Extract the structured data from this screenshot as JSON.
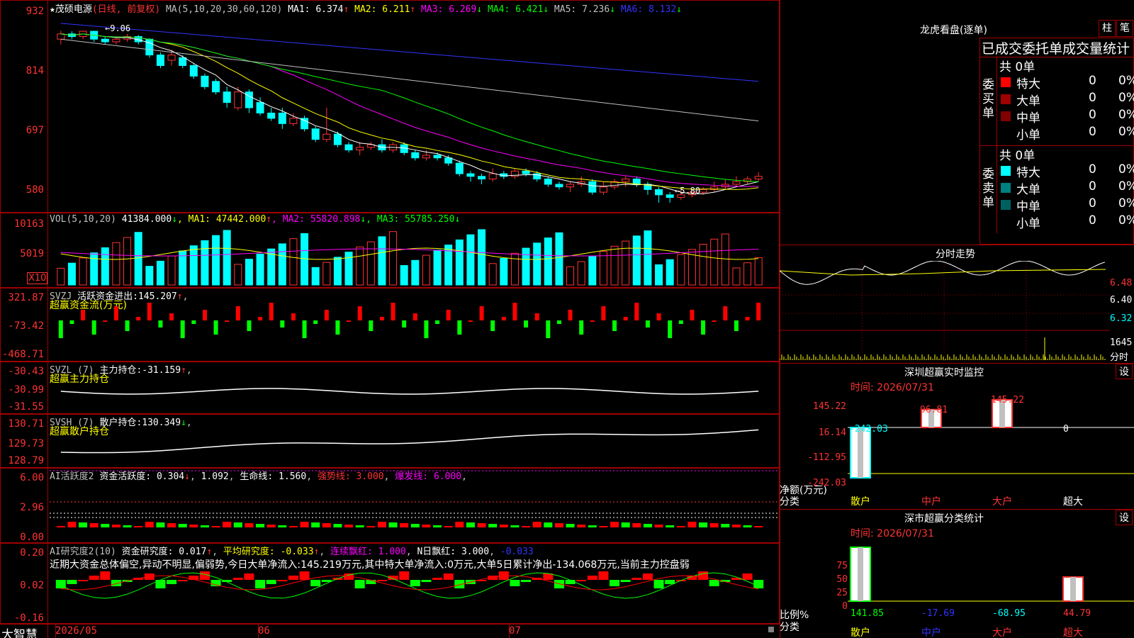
{
  "stock": {
    "star": "★",
    "name": "茂硕电源",
    "mode": "(日线, 前复权)"
  },
  "main": {
    "ma_label": "MA(5,10,20,30,60,120)",
    "ma": [
      {
        "label": "MA1:",
        "value": "6.374",
        "arrow": "↑",
        "color": "#ffffff"
      },
      {
        "label": "MA2:",
        "value": "6.211",
        "arrow": "↑",
        "color": "#ffff00"
      },
      {
        "label": "MA3:",
        "value": "6.269",
        "arrow": "↓",
        "color": "#ff00ff"
      },
      {
        "label": "MA4:",
        "value": "6.421",
        "arrow": "↓",
        "color": "#00ff00"
      },
      {
        "label": "MA5:",
        "value": "7.236",
        "arrow": "↓",
        "color": "#c0c0c0"
      },
      {
        "label": "MA6:",
        "value": "8.132",
        "arrow": "↓",
        "color": "#3333ff"
      }
    ],
    "y_labels": [
      "932",
      "814",
      "697",
      "580"
    ],
    "high_marker": "9.06",
    "low_marker": "5.80"
  },
  "vol": {
    "title": "VOL(5,10,20)",
    "value": "41384.000",
    "arrow": "↓",
    "ma": [
      {
        "label": "MA1:",
        "value": "47442.000",
        "arrow": "↑",
        "color": "#ffff00"
      },
      {
        "label": "MA2:",
        "value": "55820.898",
        "arrow": "↓",
        "color": "#ff00ff"
      },
      {
        "label": "MA3:",
        "value": "55785.250",
        "arrow": "↓",
        "color": "#00ff00"
      }
    ],
    "y_labels": [
      "10163",
      "5019"
    ],
    "unit": "X10"
  },
  "svzj": {
    "title": "SVZJ",
    "label": "活跃资金进出:",
    "value": "145.207",
    "arrow": "↑",
    "subtitle": "超赢资金流(万元)",
    "y_labels": [
      "321.87",
      "-73.42",
      "-468.71"
    ]
  },
  "svzl": {
    "title": "SVZL (7)",
    "label": "主力持仓:",
    "value": "-31.159",
    "arrow": "↑",
    "subtitle": "超赢主力持仓",
    "y_labels": [
      "-30.43",
      "-30.99",
      "-31.55"
    ]
  },
  "svsh": {
    "title": "SVSH (7)",
    "label": "散户持仓:",
    "value": "130.349",
    "arrow": "↓",
    "subtitle": "超赢散户持仓",
    "y_labels": [
      "130.71",
      "129.73",
      "128.79"
    ]
  },
  "ai1": {
    "title": "AI活跃度2",
    "label": "资金活跃度:",
    "value": "0.304",
    "value2": "1.092",
    "life_label": "生命线:",
    "life_value": "1.560",
    "strong_label": "强势线:",
    "strong_value": "3.000",
    "burst_label": "爆发线:",
    "burst_value": "6.000",
    "y_labels": [
      "6.00",
      "2.96",
      "0.00"
    ]
  },
  "ai2": {
    "title": "AI研究度2(10)",
    "label": "资金研究度:",
    "value": "0.017",
    "avg_label": "平均研究度:",
    "avg_value": "-0.033",
    "red_label": "连续飘红:",
    "red_value": "1.000",
    "n_label": "N日飘红:",
    "n_value": "3.000",
    "last_value": "-0.033",
    "comment": "近期大资金总体偏空,异动不明显,偏弱势,今日大单净流入:145.219万元,其中特大单净流入:0万元,大单5日累计净出-134.068万元,当前主力控盘弱",
    "y_labels": [
      "0.20",
      "0.02",
      "-0.16"
    ]
  },
  "xaxis": {
    "brand": "大智慧",
    "labels": [
      "2026/05",
      "06",
      "07"
    ]
  },
  "right": {
    "dragon_title": "龙虎看盘(逐单)",
    "btn_zhu": "柱",
    "btn_bi": "笔",
    "orders_title": "已成交委托单成交量统计",
    "buy": {
      "total": "共 0单",
      "side_label": "委买单",
      "rows": [
        {
          "name": "特大",
          "count": "0",
          "pct": "0%",
          "color": "#ff0000"
        },
        {
          "name": "大单",
          "count": "0",
          "pct": "0%",
          "color": "#a00000"
        },
        {
          "name": "中单",
          "count": "0",
          "pct": "0%",
          "color": "#800000"
        },
        {
          "name": "小单",
          "count": "0",
          "pct": "0%",
          "color": "#000000"
        }
      ]
    },
    "sell": {
      "total": "共 0单",
      "side_label": "委卖单",
      "rows": [
        {
          "name": "特大",
          "count": "0",
          "pct": "0%",
          "color": "#00ffff"
        },
        {
          "name": "大单",
          "count": "0",
          "pct": "0%",
          "color": "#008080"
        },
        {
          "name": "中单",
          "count": "0",
          "pct": "0%",
          "color": "#006060"
        },
        {
          "name": "小单",
          "count": "0",
          "pct": "0%",
          "color": "#000000"
        }
      ]
    },
    "intraday": {
      "title": "分时走势",
      "y_labels": [
        "6.48",
        "6.40",
        "6.32"
      ],
      "vol_label": "1645",
      "vol_caption": "分时"
    },
    "monitor": {
      "title": "深圳超赢实时监控",
      "btn": "设",
      "time": "时间: 2026/07/31",
      "y_labels": [
        "145.22",
        "16.14",
        "-112.95",
        "-242.03"
      ],
      "values": {
        "retail": "-242.03",
        "mid": "96.81",
        "big": "145.22",
        "super": "0"
      },
      "chart_data": {
        "type": "bar",
        "categories": [
          "散户",
          "中户",
          "大户",
          "超大"
        ],
        "values": [
          -242.03,
          96.81,
          145.22,
          0
        ],
        "ylabel": "净额(万元)",
        "xlabel": "分类",
        "ylim": [
          -242.03,
          145.22
        ]
      },
      "net_label": "净额(万元)",
      "cat_label": "分类",
      "categories": [
        "散户",
        "中户",
        "大户",
        "超大"
      ]
    },
    "classify": {
      "title": "深市超赢分类统计",
      "btn": "设",
      "time": "时间: 2026/07/31",
      "y_labels": [
        "75",
        "50",
        "25",
        "0"
      ],
      "values": [
        "141.85",
        "-17.69",
        "-68.95",
        "44.79"
      ],
      "chart_data": {
        "type": "bar",
        "categories": [
          "散户",
          "中户",
          "大户",
          "超大"
        ],
        "values": [
          141.85,
          -17.69,
          -68.95,
          44.79
        ],
        "ylabel": "比例%",
        "xlabel": "分类",
        "ylim": [
          0,
          100
        ]
      },
      "ratio_label": "比例%",
      "cat_label": "分类",
      "categories": [
        "散户",
        "中户",
        "大户",
        "超大"
      ]
    }
  },
  "chart_data": [
    {
      "type": "candlestick",
      "title": "茂硕电源(日线, 前复权)",
      "ylim": [
        5.8,
        9.32
      ],
      "annotations": [
        {
          "text": "9.06"
        },
        {
          "text": "5.80"
        }
      ],
      "candles": [
        [
          8.9,
          9.0,
          9.06,
          8.8
        ],
        [
          9.0,
          8.95,
          9.05,
          8.9
        ],
        [
          8.95,
          9.05,
          9.06,
          8.9
        ],
        [
          9.05,
          8.9,
          9.06,
          8.85
        ],
        [
          8.9,
          8.85,
          8.95,
          8.8
        ],
        [
          8.85,
          8.9,
          8.95,
          8.8
        ],
        [
          8.9,
          8.95,
          9.0,
          8.85
        ],
        [
          8.95,
          8.85,
          8.98,
          8.8
        ],
        [
          8.9,
          8.6,
          8.92,
          8.55
        ],
        [
          8.6,
          8.4,
          8.65,
          8.35
        ],
        [
          8.5,
          8.6,
          8.7,
          8.4
        ],
        [
          8.55,
          8.4,
          8.6,
          8.35
        ],
        [
          8.4,
          8.2,
          8.45,
          8.15
        ],
        [
          8.2,
          8.0,
          8.25,
          7.95
        ],
        [
          8.1,
          7.9,
          8.15,
          7.85
        ],
        [
          7.9,
          7.7,
          8.0,
          7.6
        ],
        [
          7.6,
          7.9,
          8.0,
          7.55
        ],
        [
          7.9,
          7.6,
          7.95,
          7.5
        ],
        [
          7.7,
          7.5,
          7.8,
          7.45
        ],
        [
          7.5,
          7.4,
          7.6,
          7.35
        ],
        [
          7.5,
          7.3,
          7.6,
          7.2
        ],
        [
          7.3,
          7.4,
          7.5,
          7.25
        ],
        [
          7.4,
          7.2,
          7.45,
          7.15
        ],
        [
          7.2,
          7.0,
          7.25,
          6.95
        ],
        [
          7.0,
          7.1,
          7.6,
          6.95
        ],
        [
          7.1,
          6.9,
          7.15,
          6.85
        ],
        [
          6.9,
          6.8,
          6.95,
          6.75
        ],
        [
          6.8,
          6.85,
          6.95,
          6.7
        ],
        [
          6.85,
          6.9,
          6.95,
          6.8
        ],
        [
          6.9,
          6.8,
          7.0,
          6.75
        ],
        [
          6.8,
          6.9,
          6.95,
          6.75
        ],
        [
          6.9,
          6.75,
          6.95,
          6.7
        ],
        [
          6.75,
          6.65,
          6.8,
          6.6
        ],
        [
          6.65,
          6.7,
          6.8,
          6.6
        ],
        [
          6.7,
          6.65,
          6.75,
          6.6
        ],
        [
          6.65,
          6.55,
          6.7,
          6.5
        ],
        [
          6.55,
          6.35,
          6.6,
          6.3
        ],
        [
          6.35,
          6.3,
          6.4,
          6.2
        ],
        [
          6.3,
          6.25,
          6.35,
          6.15
        ],
        [
          6.25,
          6.35,
          6.45,
          6.2
        ],
        [
          6.35,
          6.3,
          6.4,
          6.25
        ],
        [
          6.3,
          6.4,
          6.45,
          6.25
        ],
        [
          6.4,
          6.35,
          6.45,
          6.3
        ],
        [
          6.35,
          6.25,
          6.4,
          6.2
        ],
        [
          6.25,
          6.15,
          6.3,
          6.1
        ],
        [
          6.15,
          6.1,
          6.2,
          6.05
        ],
        [
          6.1,
          6.15,
          6.2,
          6.0
        ],
        [
          6.15,
          6.2,
          6.3,
          6.1
        ],
        [
          6.2,
          6.0,
          6.25,
          5.95
        ],
        [
          6.0,
          6.1,
          6.2,
          5.95
        ],
        [
          6.1,
          6.2,
          6.25,
          6.05
        ],
        [
          6.2,
          6.25,
          6.3,
          6.1
        ],
        [
          6.25,
          6.15,
          6.3,
          6.1
        ],
        [
          6.15,
          6.05,
          6.2,
          5.95
        ],
        [
          6.05,
          5.95,
          6.1,
          5.8
        ],
        [
          5.95,
          5.9,
          6.0,
          5.8
        ],
        [
          5.9,
          5.95,
          6.05,
          5.85
        ],
        [
          5.95,
          6.0,
          6.05,
          5.9
        ],
        [
          6.0,
          6.05,
          6.1,
          5.95
        ],
        [
          6.05,
          6.1,
          6.2,
          6.0
        ],
        [
          6.1,
          6.15,
          6.25,
          6.05
        ],
        [
          6.15,
          6.2,
          6.3,
          6.1
        ],
        [
          6.2,
          6.25,
          6.3,
          6.15
        ],
        [
          6.25,
          6.3,
          6.38,
          6.2
        ]
      ]
    }
  ]
}
